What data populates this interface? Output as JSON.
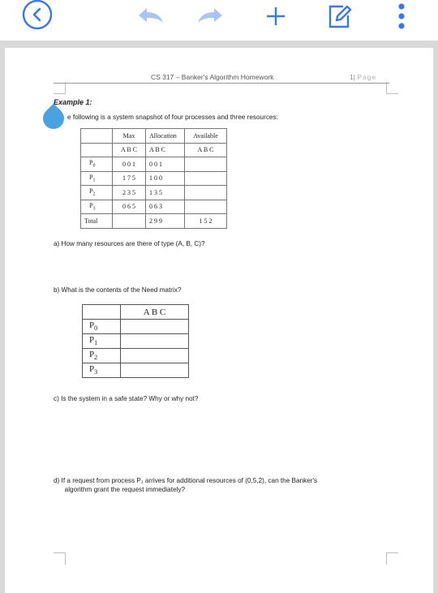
{
  "toolbar": {
    "icons": [
      "back-icon",
      "undo-icon",
      "redo-icon",
      "add-icon",
      "edit-icon",
      "more-icon"
    ],
    "accent": "#3b78e7",
    "inactive": "#a9c5f5"
  },
  "header": {
    "title": "CS 317 – Banker's Algorithm Homework",
    "page_number": "1",
    "page_sep": "|",
    "page_word": "Page"
  },
  "doc": {
    "example_title": "Example 1:",
    "intro": "e following is a system snapshot of four processes and three resources:",
    "snapshot": {
      "headers": [
        "",
        "Max",
        "Allocation",
        "Available"
      ],
      "subheaders": [
        "",
        "A B C",
        "A B C",
        "A B C"
      ],
      "rows": [
        {
          "p": "P",
          "sub": "0",
          "max": "0 0 1",
          "alloc": "0 0 1",
          "avail": ""
        },
        {
          "p": "P",
          "sub": "1",
          "max": "1 7 5",
          "alloc": "1 0 0",
          "avail": ""
        },
        {
          "p": "P",
          "sub": "2",
          "max": "2 3 5",
          "alloc": "1 3 5",
          "avail": ""
        },
        {
          "p": "P",
          "sub": "3",
          "max": "0 6 5",
          "alloc": "0 6 3",
          "avail": ""
        }
      ],
      "total": {
        "label": "Total",
        "max": "",
        "alloc": "2 9 9",
        "avail": "1 5 2"
      }
    },
    "q_a": "a)   How many resources are there of type (A, B, C)?",
    "q_b": "b)   What is the contents of the Need matrix?",
    "need": {
      "header": "A B C",
      "rows": [
        {
          "p": "P",
          "sub": "0"
        },
        {
          "p": "P",
          "sub": "1"
        },
        {
          "p": "P",
          "sub": "2"
        },
        {
          "p": "P",
          "sub": "3"
        }
      ]
    },
    "q_c": "c)   Is the system in a safe state? Why or why not?",
    "q_d_line1": "d)   If a request from process P₁ arrives for additional resources of (0,5,2), can the Banker's",
    "q_d_line2": "      algorithm grant the request immediately?"
  }
}
